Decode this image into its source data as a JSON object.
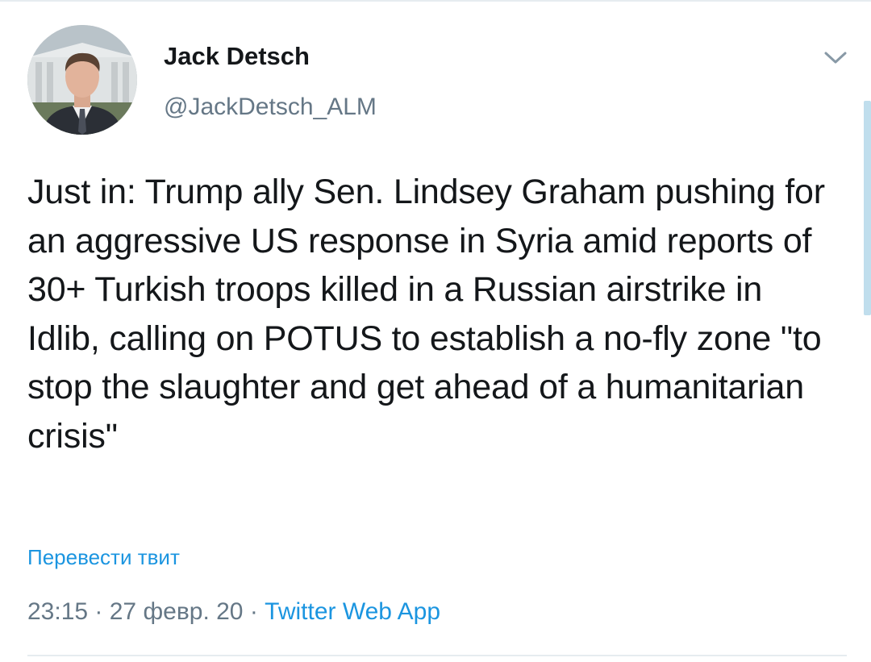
{
  "tweet": {
    "author_name": "Jack Detsch",
    "author_handle": "@JackDetsch_ALM",
    "text": "Just in: Trump ally Sen. Lindsey Graham pushing for an aggressive US response in Syria amid reports of 30+ Turkish troops killed in a Russian airstrike in Idlib, calling on POTUS to establish a no-fly zone \"to stop the slaughter and get ahead of a humanitarian crisis\"",
    "translate_label": "Перевести твит",
    "time": "23:15",
    "date": "27 февр. 20",
    "separator": " · ",
    "source": "Twitter Web App"
  },
  "icons": {
    "menu": "chevron-down-icon"
  },
  "colors": {
    "text": "#14171a",
    "secondary": "#657786",
    "link": "#1b95e0",
    "divider": "#e6ecf0"
  }
}
